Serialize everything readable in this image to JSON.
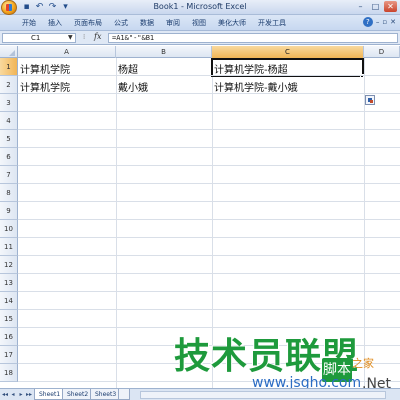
{
  "window": {
    "title": "Book1 - Microsoft Excel"
  },
  "quick_access": [
    {
      "name": "save-icon",
      "glyph": "▪"
    },
    {
      "name": "undo-icon",
      "glyph": "↶"
    },
    {
      "name": "redo-icon",
      "glyph": "↷"
    },
    {
      "name": "dropdown-icon",
      "glyph": "▾"
    }
  ],
  "window_controls": {
    "minimize": "–",
    "maximize": "□",
    "close": "✕"
  },
  "ribbon_tabs": [
    "开始",
    "插入",
    "页面布局",
    "公式",
    "数据",
    "审阅",
    "视图",
    "美化大师",
    "开发工具"
  ],
  "help": {
    "min": "–",
    "restore": "▫",
    "close": "✕",
    "question": "?"
  },
  "formula_bar": {
    "name_box": "C1",
    "fx": "fx",
    "formula": "=A1&\"-\"&B1"
  },
  "columns": [
    "A",
    "B",
    "C",
    "D"
  ],
  "selected_column": "C",
  "rows": [
    "1",
    "2",
    "3",
    "4",
    "5",
    "6",
    "7",
    "8",
    "9",
    "10",
    "11",
    "12",
    "13",
    "14",
    "15",
    "16",
    "17",
    "18"
  ],
  "selected_row": "1",
  "cells": {
    "A1": "计算机学院",
    "B1": "杨超",
    "C1": "计算机学院-杨超",
    "A2": "计算机学院",
    "B2": "戴小娥",
    "C2": "计算机学院-戴小娥"
  },
  "sheet_nav": [
    "◂◂",
    "◂",
    "▸",
    "▸▸"
  ],
  "sheets": [
    {
      "label": "Sheet1",
      "active": true
    },
    {
      "label": "Sheet2",
      "active": false
    },
    {
      "label": "Sheet3",
      "active": false
    }
  ],
  "watermark": {
    "main": "技术员联盟",
    "badge": "脚本",
    "tag": "之家",
    "site": "www.jsgho.com",
    "net": ".Net"
  },
  "colors": {
    "accent": "#f1b556",
    "watermark_green": "#1e9a3c",
    "watermark_blue": "#2b6cc4"
  }
}
